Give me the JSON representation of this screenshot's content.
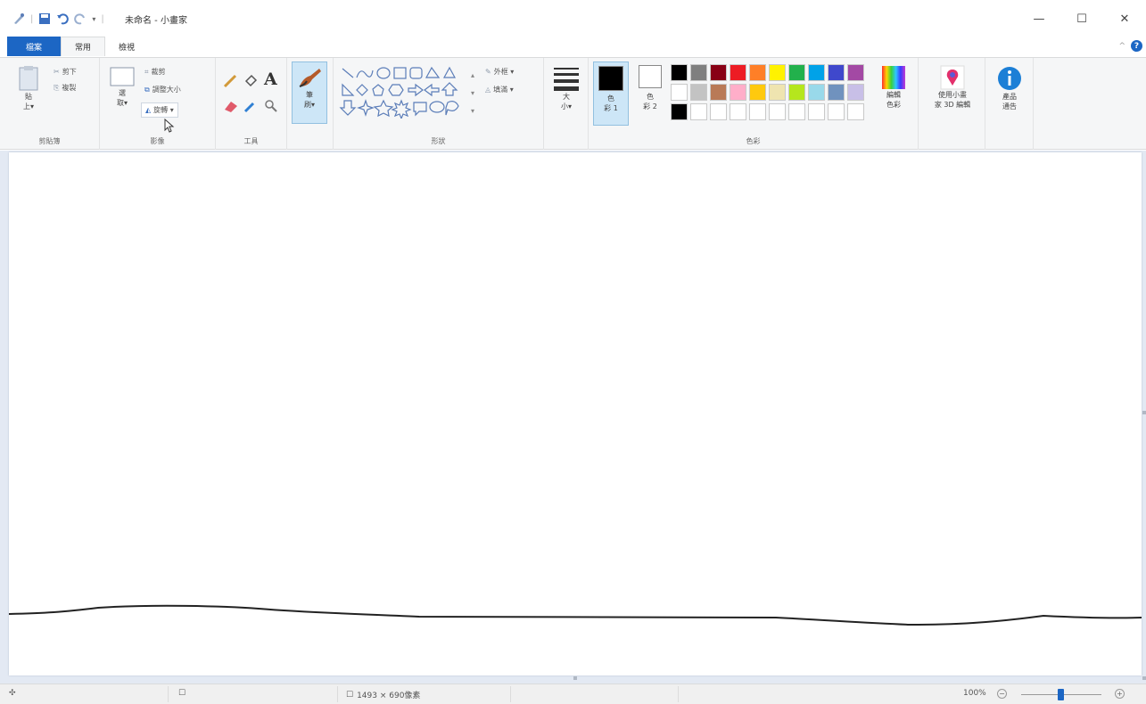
{
  "window": {
    "title": "未命名 - 小畫家",
    "minimize_glyph": "—",
    "maximize_glyph": "☐",
    "close_glyph": "✕"
  },
  "tabs": {
    "file": "檔案",
    "home": "常用",
    "view": "檢視"
  },
  "ribbon": {
    "clipboard": {
      "label": "剪貼簿",
      "paste": "貼\n上▾",
      "cut": "剪下",
      "copy": "複製"
    },
    "image": {
      "label": "影像",
      "select": "選\n取▾",
      "crop": "裁剪",
      "resize": "調整大小",
      "rotate": "旋轉 ▾"
    },
    "tools": {
      "label": "工具"
    },
    "brushes": {
      "label": "筆\n刷▾"
    },
    "shapes": {
      "label": "形狀",
      "outline": "外框 ▾",
      "fill": "填滿 ▾"
    },
    "size": {
      "label": "大\n小▾"
    },
    "colors": {
      "label": "色彩",
      "color1": "色\n彩 1",
      "color2": "色\n彩 2",
      "edit_colors": "編輯\n色彩"
    },
    "paint3d": "使用小畫\n家 3D 編輯",
    "product_alert": "產品\n通告"
  },
  "palette": {
    "row1": [
      "#000000",
      "#7f7f7f",
      "#880015",
      "#ed1c24",
      "#ff7f27",
      "#fff200",
      "#22b14c",
      "#00a2e8",
      "#3f48cc",
      "#a349a4"
    ],
    "row2": [
      "#ffffff",
      "#c3c3c3",
      "#b97a57",
      "#ffaec9",
      "#ffc90e",
      "#efe4b0",
      "#b5e61d",
      "#99d9ea",
      "#7092be",
      "#c8bfe7"
    ],
    "row3": [
      "#000000",
      "#ffffff",
      "#ffffff",
      "#ffffff",
      "#ffffff",
      "#ffffff",
      "#ffffff",
      "#ffffff",
      "#ffffff",
      "#ffffff"
    ]
  },
  "colors_current": {
    "color1": "#000000",
    "color2": "#ffffff"
  },
  "status": {
    "dimensions": "1493 × 690像素",
    "zoom": "100%",
    "zoom_minus": "−",
    "zoom_plus": "+"
  }
}
